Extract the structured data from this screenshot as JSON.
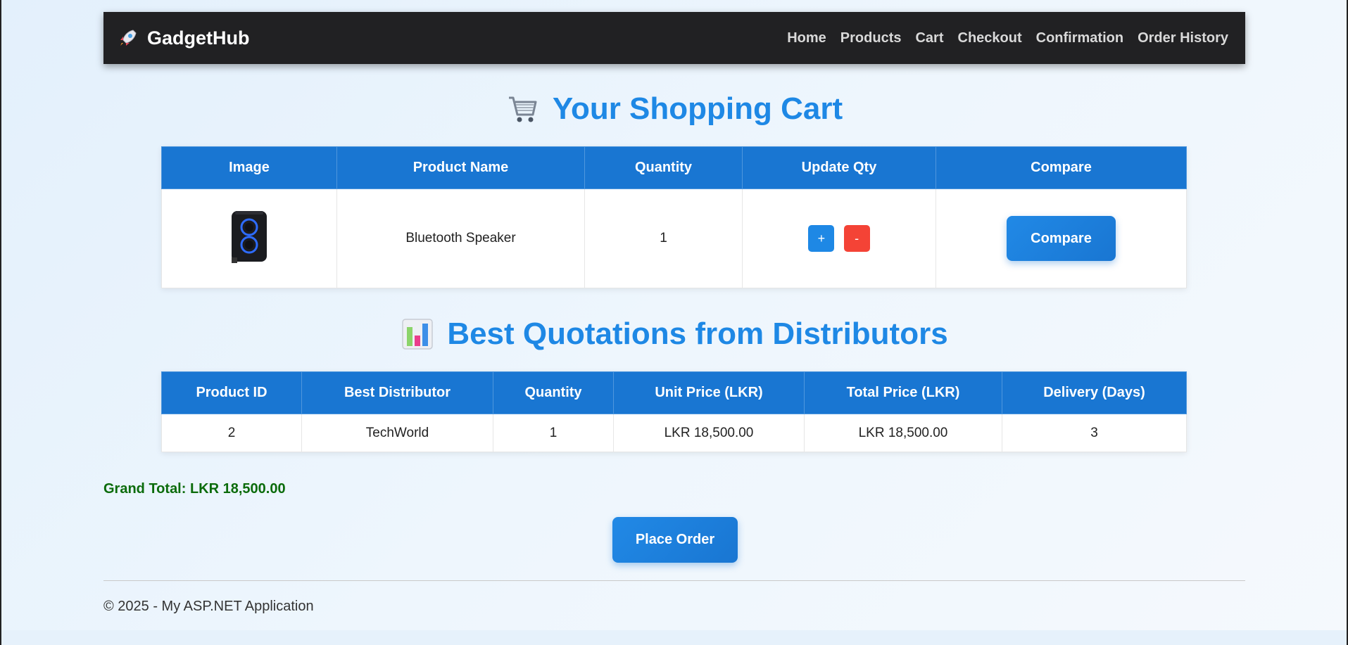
{
  "navbar": {
    "brand": "GadgetHub",
    "brand_icon": "rocket-icon",
    "links": [
      "Home",
      "Products",
      "Cart",
      "Checkout",
      "Confirmation",
      "Order History"
    ]
  },
  "cart": {
    "title": "Your Shopping Cart",
    "title_icon": "shopping-cart-icon",
    "headers": [
      "Image",
      "Product Name",
      "Quantity",
      "Update Qty",
      "Compare"
    ],
    "rows": [
      {
        "image_icon": "bluetooth-speaker-image",
        "product_name": "Bluetooth Speaker",
        "quantity": "1",
        "plus_label": "+",
        "minus_label": "-",
        "compare_label": "Compare"
      }
    ]
  },
  "quotations": {
    "title": "Best Quotations from Distributors",
    "title_icon": "bar-chart-icon",
    "headers": [
      "Product ID",
      "Best Distributor",
      "Quantity",
      "Unit Price (LKR)",
      "Total Price (LKR)",
      "Delivery (Days)"
    ],
    "rows": [
      {
        "product_id": "2",
        "distributor": "TechWorld",
        "quantity": "1",
        "unit_price": "LKR 18,500.00",
        "total_price": "LKR 18,500.00",
        "delivery_days": "3"
      }
    ]
  },
  "grand_total": "Grand Total: LKR 18,500.00",
  "place_order_label": "Place Order",
  "footer": "© 2025 - My ASP.NET Application",
  "colors": {
    "navbar_bg": "#212123",
    "accent": "#1976d2",
    "title": "#1e88e5",
    "minus": "#f44336",
    "grand_total": "#0b6b0b"
  }
}
